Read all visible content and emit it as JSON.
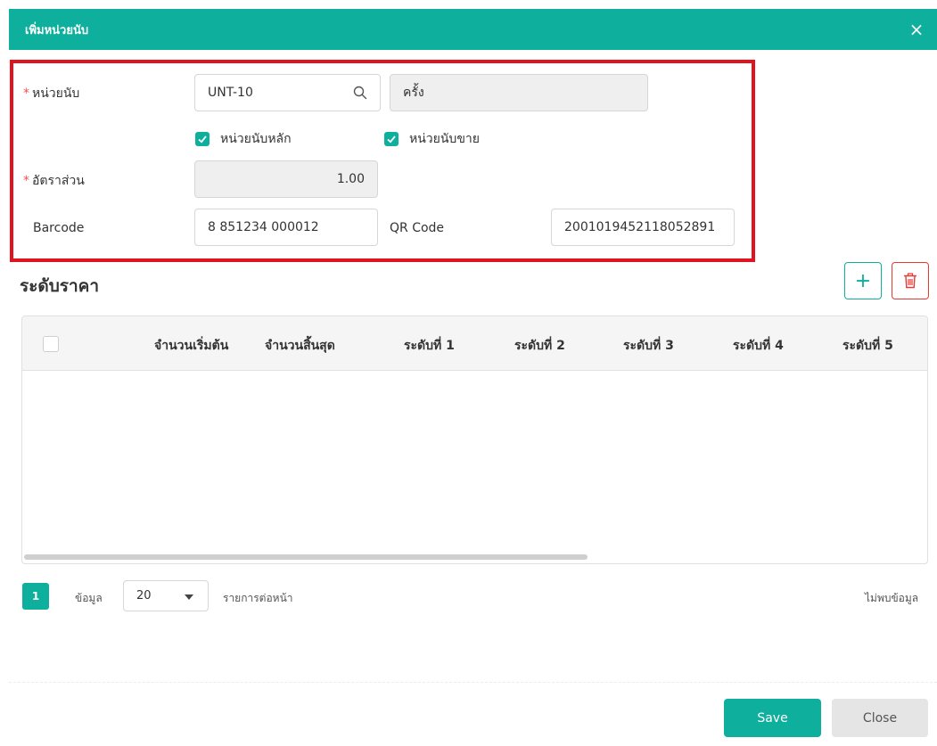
{
  "dialog": {
    "title": "เพิ่มหน่วยนับ",
    "close_icon": "×"
  },
  "form": {
    "unit_label": "หน่วยนับ",
    "unit_code": "UNT-10",
    "unit_name": "ครั้ง",
    "main_unit_label": "หน่วยนับหลัก",
    "main_unit_checked": true,
    "sale_unit_label": "หน่วยนับขาย",
    "sale_unit_checked": true,
    "ratio_label": "อัตราส่วน",
    "ratio_value": "1.00",
    "barcode_label": "Barcode",
    "barcode_value": "8 851234 000012",
    "qrcode_label": "QR Code",
    "qrcode_value": "2001019452118052891"
  },
  "price_levels": {
    "title": "ระดับราคา",
    "add_icon": "+",
    "columns": [
      "จำนวนเริ่มต้น",
      "จำนวนสิ้นสุด",
      "ระดับที่ 1",
      "ระดับที่ 2",
      "ระดับที่ 3",
      "ระดับที่ 4",
      "ระดับที่ 5"
    ],
    "rows": []
  },
  "pagination": {
    "current_page": "1",
    "data_label": "ข้อมูล",
    "per_page": "20",
    "per_page_label": "รายการต่อหน้า",
    "empty_text": "ไม่พบข้อมูล"
  },
  "footer": {
    "save_label": "Save",
    "close_label": "Close"
  },
  "colors": {
    "accent": "#0eaf9c",
    "danger": "#e53935",
    "highlight": "#e0141e"
  }
}
